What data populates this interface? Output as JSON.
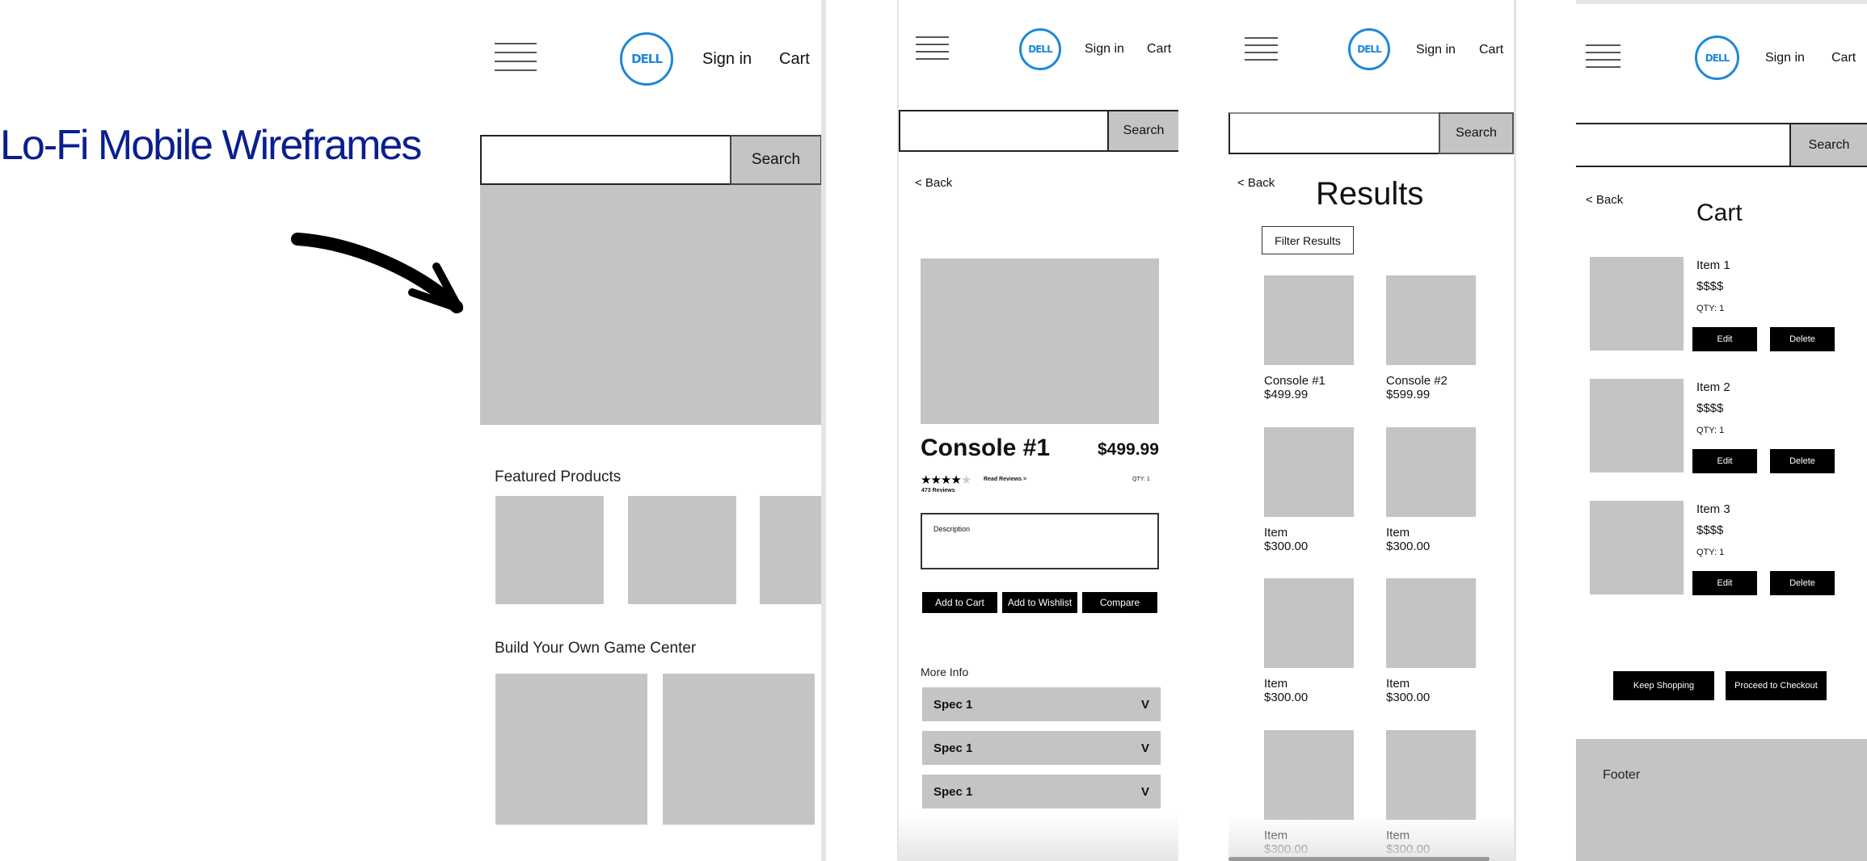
{
  "title": "Lo-Fi Mobile Wireframes",
  "colors": {
    "title": "#0a1f8f",
    "logo": "#1e88d6",
    "placeholder": "#c4c4c4",
    "button": "#000000"
  },
  "header": {
    "menu_icon": "hamburger-icon",
    "logo_text": "DELL",
    "sign_in": "Sign in",
    "cart": "Cart",
    "search_button": "Search",
    "search_placeholder": ""
  },
  "home": {
    "featured_heading": "Featured Products",
    "build_heading": "Build Your Own Game Center"
  },
  "product": {
    "back": "< Back",
    "name": "Console #1",
    "price": "$499.99",
    "rating": 4,
    "rating_max": 5,
    "read_reviews": "Read Reviews >",
    "review_count": "473 Reviews",
    "qty": "QTY: 1",
    "description": "Description",
    "buttons": [
      "Add to Cart",
      "Add to Wishlist",
      "Compare"
    ],
    "more_info": "More Info",
    "specs": [
      {
        "label": "Spec 1",
        "chevron": "V"
      },
      {
        "label": "Spec 1",
        "chevron": "V"
      },
      {
        "label": "Spec 1",
        "chevron": "V"
      }
    ]
  },
  "results": {
    "back": "< Back",
    "heading": "Results",
    "filter": "Filter Results",
    "items": [
      {
        "name": "Console #1",
        "price": "$499.99"
      },
      {
        "name": "Console #2",
        "price": "$599.99"
      },
      {
        "name": "Item",
        "price": "$300.00"
      },
      {
        "name": "Item",
        "price": "$300.00"
      },
      {
        "name": "Item",
        "price": "$300.00"
      },
      {
        "name": "Item",
        "price": "$300.00"
      },
      {
        "name": "Item",
        "price": "$300.00"
      },
      {
        "name": "Item",
        "price": "$300.00"
      }
    ]
  },
  "cart": {
    "back": "< Back",
    "heading": "Cart",
    "items": [
      {
        "name": "Item 1",
        "price": "$$$$",
        "qty": "QTY: 1",
        "edit": "Edit",
        "delete": "Delete"
      },
      {
        "name": "Item 2",
        "price": "$$$$",
        "qty": "QTY: 1",
        "edit": "Edit",
        "delete": "Delete"
      },
      {
        "name": "Item 3",
        "price": "$$$$",
        "qty": "QTY: 1",
        "edit": "Edit",
        "delete": "Delete"
      }
    ],
    "keep_shopping": "Keep Shopping",
    "checkout": "Proceed to Checkout",
    "footer": "Footer"
  }
}
